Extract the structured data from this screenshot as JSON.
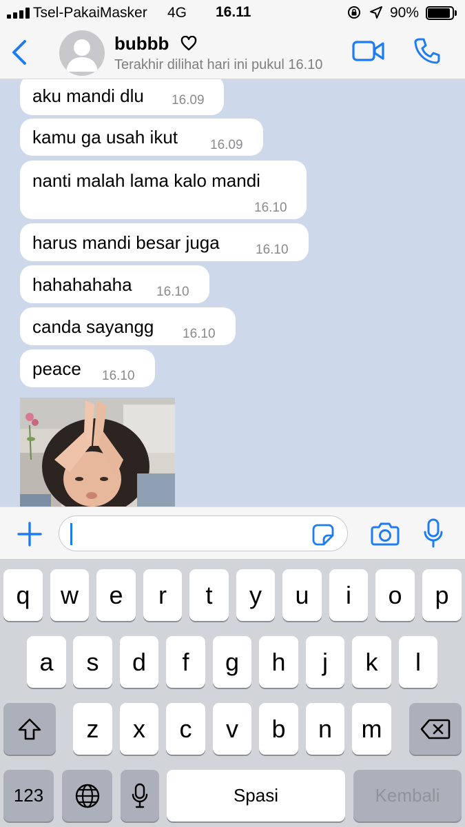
{
  "status_bar": {
    "carrier": "Tsel-PakaiMasker",
    "network": "4G",
    "time": "16.11",
    "battery_pct": "90%",
    "battery_level": 0.9
  },
  "header": {
    "contact_name": "bubbb",
    "last_seen": "Terakhir dilihat hari ini pukul 16.10",
    "accent_color": "#1e7cf2"
  },
  "messages": [
    {
      "text": "aku mandi dlu",
      "time": "16.09"
    },
    {
      "text": "kamu ga usah ikut",
      "time": "16.09"
    },
    {
      "text": "nanti malah lama kalo mandi",
      "time": "16.10"
    },
    {
      "text": "harus mandi besar juga",
      "time": "16.10"
    },
    {
      "text": "hahahahaha",
      "time": "16.10"
    },
    {
      "text": "canda sayangg",
      "time": "16.10"
    },
    {
      "text": "peace",
      "time": "16.10"
    }
  ],
  "photo": {
    "icon": "child-praying-photo"
  },
  "input": {
    "value": ""
  },
  "keyboard": {
    "row1": [
      "q",
      "w",
      "e",
      "r",
      "t",
      "y",
      "u",
      "i",
      "o",
      "p"
    ],
    "row2": [
      "a",
      "s",
      "d",
      "f",
      "g",
      "h",
      "j",
      "k",
      "l"
    ],
    "row3": [
      "z",
      "x",
      "c",
      "v",
      "b",
      "n",
      "m"
    ],
    "numbers_label": "123",
    "space_label": "Spasi",
    "return_label": "Kembali"
  }
}
